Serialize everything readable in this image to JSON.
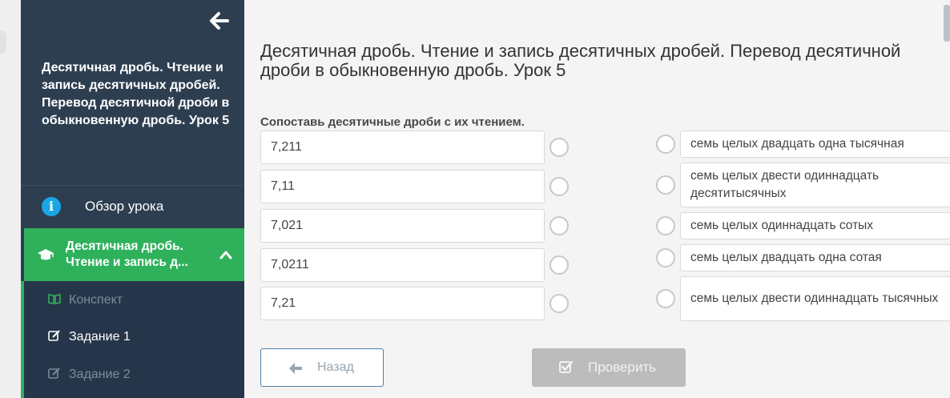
{
  "sidebar": {
    "lesson_title": "Десятичная дробь. Чтение и запись десятичных дробей. Перевод десятичной дроби в обыкновенную дробь. Урок 5",
    "overview_label": "Обзор урока",
    "active_lesson_line1": "Десятичная дробь.",
    "active_lesson_line2": "Чтение и запись д...",
    "sub_items": [
      {
        "label": "Конспект",
        "icon": "book-icon"
      },
      {
        "label": "Задание 1",
        "icon": "edit-icon"
      },
      {
        "label": "Задание 2",
        "icon": "edit-icon"
      }
    ]
  },
  "main": {
    "title": "Десятичная дробь. Чтение и запись десятичных дробей. Перевод десятичной дроби в обыкновенную дробь. Урок 5",
    "task_instruction": "Сопоставь десятичные дроби с их чтением.",
    "left_items": [
      "7,211",
      "7,11",
      "7,021",
      "7,0211",
      "7,21"
    ],
    "right_items": [
      "семь целых двадцать одна тысячная",
      "семь целых двести одиннадцать десятитысячных",
      "семь целых одиннадцать сотых",
      "семь целых двадцать одна сотая",
      "семь целых двести одиннадцать тысячных"
    ],
    "back_button": "Назад",
    "check_button": "Проверить"
  },
  "colors": {
    "sidebar_bg": "#2d3e50",
    "active_green": "#2fb15c",
    "info_blue": "#1aa6e4",
    "disabled_button": "#bcbcbc"
  }
}
